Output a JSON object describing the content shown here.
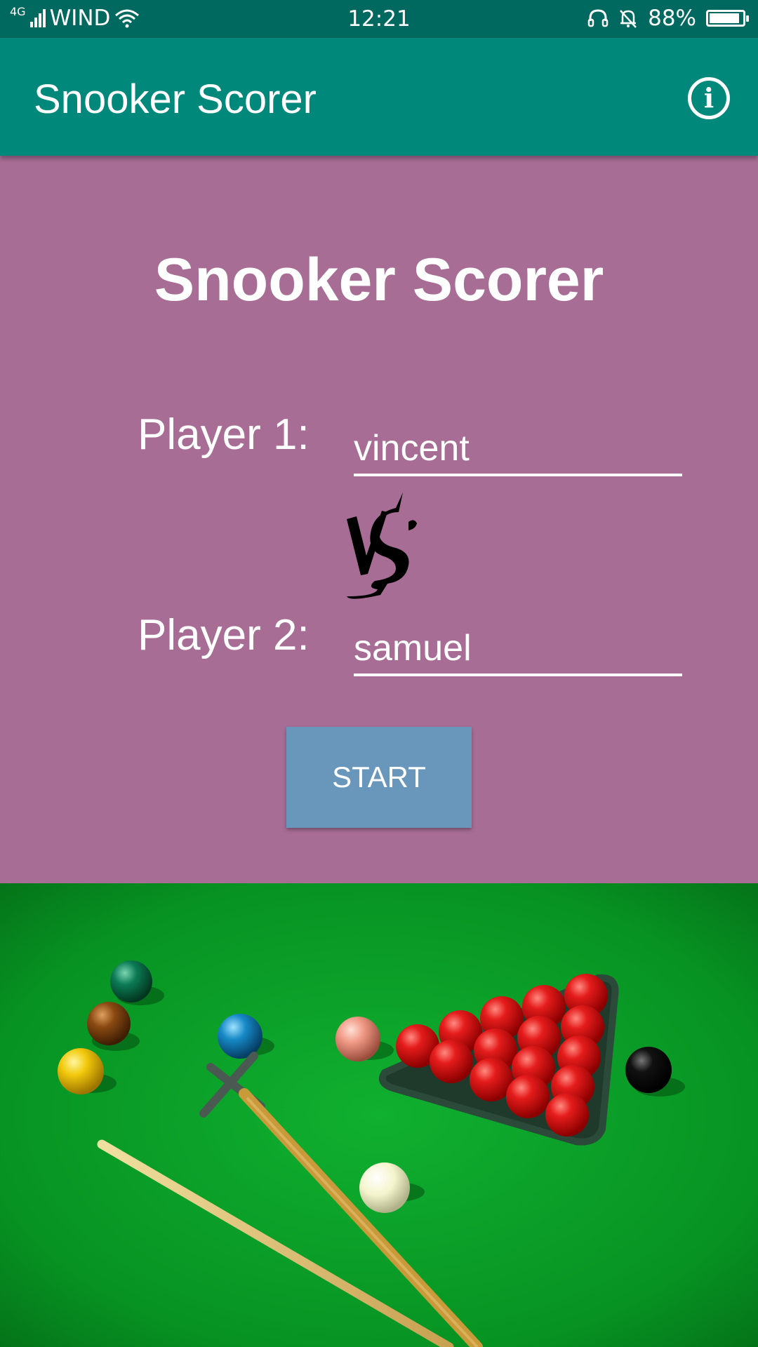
{
  "status_bar": {
    "network_type": "4G",
    "carrier": "WIND",
    "time": "12:21",
    "battery_percent": "88%",
    "battery_level": 0.88,
    "icons": [
      "signal-icon",
      "wifi-icon",
      "headset-icon",
      "alarm-off-icon",
      "battery-icon"
    ]
  },
  "app_bar": {
    "title": "Snooker Scorer",
    "info_icon": "info-icon"
  },
  "main": {
    "title": "Snooker Scorer",
    "player1": {
      "label": "Player 1:",
      "value": "vincent"
    },
    "player2": {
      "label": "Player 2:",
      "value": "samuel"
    },
    "versus_logo": "VS",
    "start_label": "START"
  },
  "colors": {
    "status_bar": "#00695f",
    "app_bar": "#00897b",
    "background": "#a76d94",
    "start_button": "#6996bb",
    "table_felt": "#0a9b27"
  }
}
